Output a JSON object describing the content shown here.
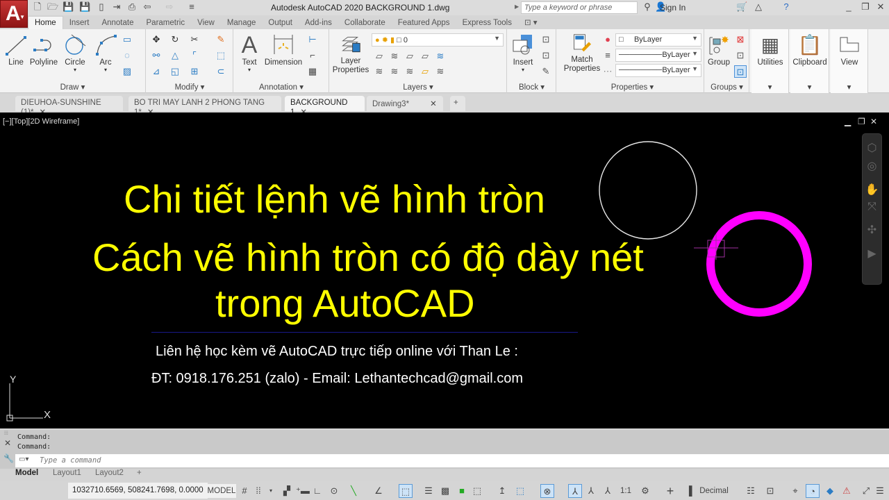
{
  "app": {
    "title": "Autodesk AutoCAD 2020   BACKGROUND 1.dwg",
    "logo_letter": "A"
  },
  "search": {
    "placeholder": "Type a keyword or phrase"
  },
  "account": {
    "sign_in": "Sign In"
  },
  "ribbon_tabs": [
    "Home",
    "Insert",
    "Annotate",
    "Parametric",
    "View",
    "Manage",
    "Output",
    "Add-ins",
    "Collaborate",
    "Featured Apps",
    "Express Tools"
  ],
  "panels": {
    "draw": {
      "title": "Draw",
      "buttons": [
        "Line",
        "Polyline",
        "Circle",
        "Arc"
      ]
    },
    "modify": {
      "title": "Modify"
    },
    "annotation": {
      "title": "Annotation",
      "buttons": [
        "Text",
        "Dimension"
      ]
    },
    "layers": {
      "title": "Layers",
      "button": "Layer\nProperties",
      "layer_value": "0"
    },
    "block": {
      "title": "Block",
      "button": "Insert"
    },
    "properties": {
      "title": "Properties",
      "button": "Match\nProperties",
      "color": "ByLayer",
      "lineweight": "ByLayer",
      "linetype": "ByLayer"
    },
    "groups": {
      "title": "Groups",
      "button": "Group"
    },
    "utilities": {
      "label": "Utilities"
    },
    "clipboard": {
      "label": "Clipboard"
    },
    "view": {
      "label": "View"
    }
  },
  "doc_tabs": [
    {
      "label": "DIEUHOA-SUNSHINE (1)*",
      "active": false
    },
    {
      "label": "BO TRI MAY LANH 2 PHONG TANG 1*",
      "active": false
    },
    {
      "label": "BACKGROUND 1",
      "active": true
    },
    {
      "label": "Drawing3*",
      "active": false
    }
  ],
  "viewport": {
    "label": "[−][Top][2D Wireframe]"
  },
  "drawing": {
    "line1": "Chi tiết lệnh vẽ hình tròn",
    "line2": "Cách vẽ hình tròn có độ dày nét",
    "line3": "trong AutoCAD",
    "contact1": "Liên hệ học kèm vẽ AutoCAD trực tiếp online với Than Le :",
    "contact2": "ĐT: 0918.176.251 (zalo)  - Email: Lethantechcad@gmail.com",
    "colors": {
      "title": "#ffff00",
      "thick_circle": "#ff00ff",
      "thin_circle": "#ffffff"
    }
  },
  "ucs": {
    "x": "X",
    "y": "Y"
  },
  "command": {
    "history": [
      "Command:",
      "Command:"
    ],
    "placeholder": "Type a command"
  },
  "layout_tabs": [
    "Model",
    "Layout1",
    "Layout2",
    "+"
  ],
  "status": {
    "coords": "1032710.6569, 508241.7698, 0.0000",
    "space": "MODEL",
    "scale": "1:1",
    "units": "Decimal"
  }
}
